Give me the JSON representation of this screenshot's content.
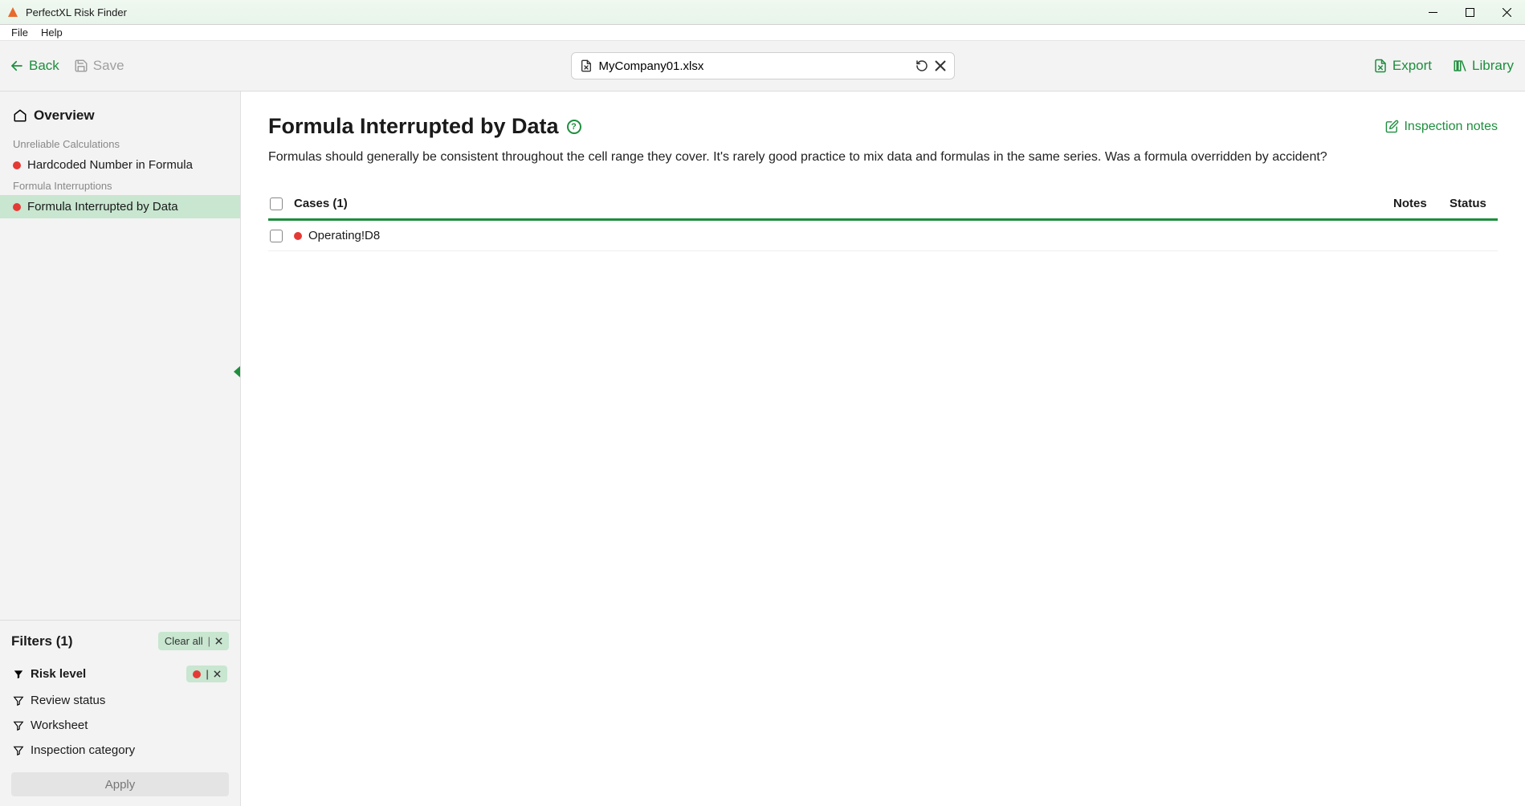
{
  "titlebar": {
    "title": "PerfectXL Risk Finder"
  },
  "menu": {
    "file": "File",
    "help": "Help"
  },
  "toolbar": {
    "back": "Back",
    "save": "Save",
    "filename": "MyCompany01.xlsx",
    "export": "Export",
    "library": "Library"
  },
  "sidebar": {
    "overview": "Overview",
    "groups": [
      {
        "label": "Unreliable Calculations",
        "items": [
          {
            "label": "Hardcoded Number in Formula",
            "active": false
          }
        ]
      },
      {
        "label": "Formula Interruptions",
        "items": [
          {
            "label": "Formula Interrupted by Data",
            "active": true
          }
        ]
      }
    ]
  },
  "filters": {
    "title": "Filters (1)",
    "clear_all": "Clear all",
    "risk_level": "Risk level",
    "review_status": "Review status",
    "worksheet": "Worksheet",
    "inspection_category": "Inspection category",
    "apply": "Apply"
  },
  "main": {
    "title": "Formula Interrupted by Data",
    "inspection_notes": "Inspection notes",
    "description": "Formulas should generally be consistent throughout the cell range they cover. It's rarely good practice to mix data and formulas in the same series. Was a formula overridden by accident?",
    "cases_header": "Cases (1)",
    "notes_header": "Notes",
    "status_header": "Status",
    "cases": [
      {
        "name": "Operating!D8"
      }
    ]
  }
}
